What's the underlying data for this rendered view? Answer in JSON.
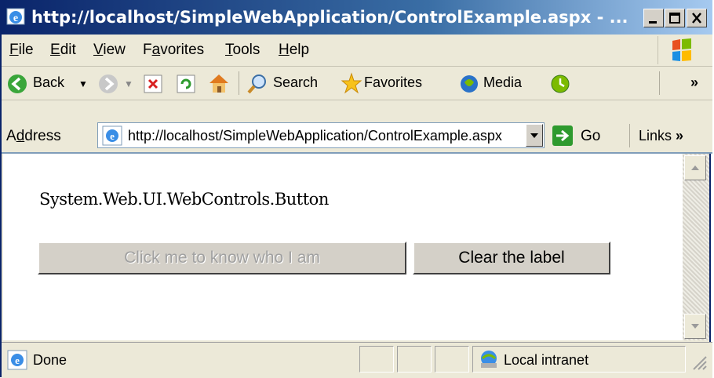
{
  "window": {
    "title": "http://localhost/SimpleWebApplication/ControlExample.aspx - ..."
  },
  "menu": {
    "items": [
      {
        "label": "File",
        "key": "F",
        "rest": "ile"
      },
      {
        "label": "Edit",
        "key": "E",
        "rest": "dit"
      },
      {
        "label": "View",
        "key": "V",
        "rest": "iew"
      },
      {
        "label": "Favorites",
        "pre": "F",
        "key": "a",
        "rest": "vorites"
      },
      {
        "label": "Tools",
        "key": "T",
        "rest": "ools"
      },
      {
        "label": "Help",
        "key": "H",
        "rest": "elp"
      }
    ]
  },
  "toolbar": {
    "back_label": "Back",
    "search_label": "Search",
    "favorites_label": "Favorites",
    "media_label": "Media",
    "more_glyph": "»"
  },
  "address": {
    "label_pre": "A",
    "label_key": "d",
    "label_rest": "dress",
    "url": "http://localhost/SimpleWebApplication/ControlExample.aspx",
    "go_label": "Go",
    "links_label": "Links",
    "links_more": "»"
  },
  "page": {
    "label_text": "System.Web.UI.WebControls.Button",
    "button_disabled_label": "Click me to know who I am",
    "button_clear_label": "Clear the label"
  },
  "status": {
    "text": "Done",
    "zone": "Local intranet"
  },
  "colors": {
    "titlebar": "#0a246a",
    "chrome": "#ece9d8",
    "button_face": "#d4d0c8"
  }
}
